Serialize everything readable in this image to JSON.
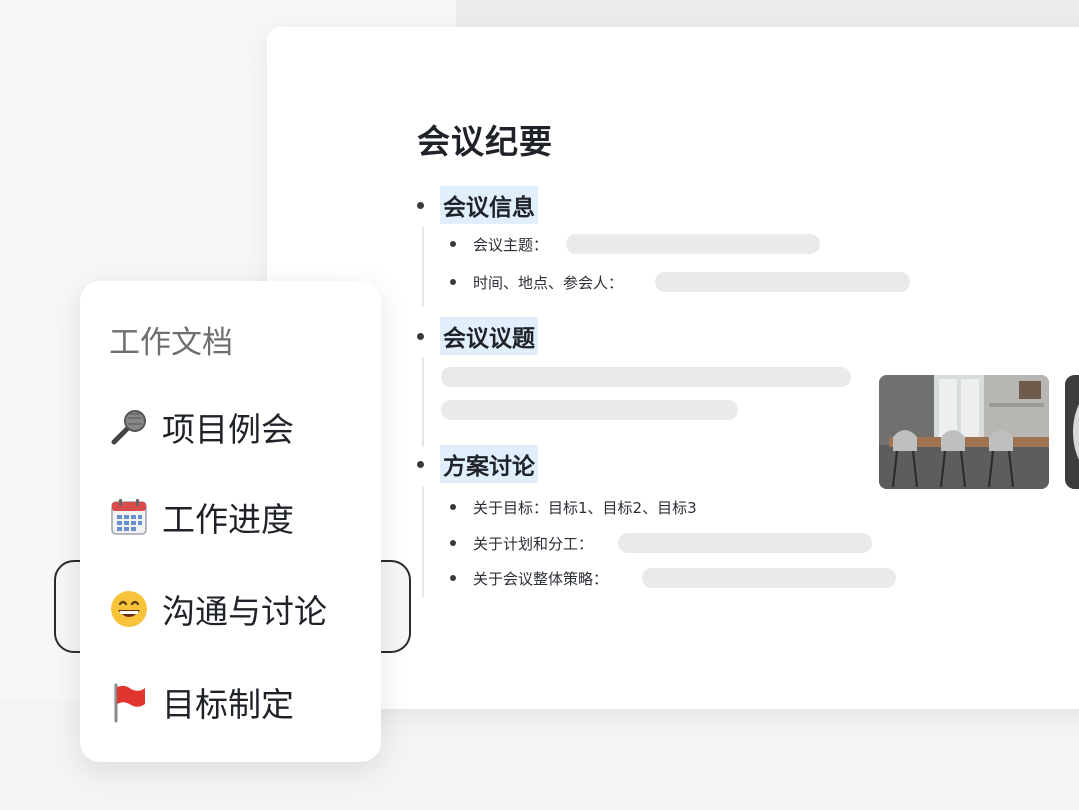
{
  "document": {
    "title": "会议纪要",
    "sections": [
      {
        "heading": "会议信息",
        "items": [
          {
            "label": "会议主题："
          },
          {
            "label": "时间、地点、参会人："
          }
        ]
      },
      {
        "heading": "会议议题",
        "items": []
      },
      {
        "heading": "方案讨论",
        "items": [
          {
            "label": "关于目标：目标1、目标2、目标3"
          },
          {
            "label": "关于计划和分工："
          },
          {
            "label": "关于会议整体策略："
          }
        ]
      }
    ]
  },
  "menu": {
    "heading": "工作文档",
    "selected_index": 2,
    "items": [
      {
        "icon": "microphone-icon",
        "label": "项目例会"
      },
      {
        "icon": "calendar-icon",
        "label": "工作进度"
      },
      {
        "icon": "grinning-face-icon",
        "label": "沟通与讨论"
      },
      {
        "icon": "red-flag-icon",
        "label": "目标制定"
      }
    ]
  },
  "colors": {
    "highlight": "#e1eefb",
    "placeholder_bar": "#eaeaea",
    "selected_border": "#2c2c2c"
  }
}
